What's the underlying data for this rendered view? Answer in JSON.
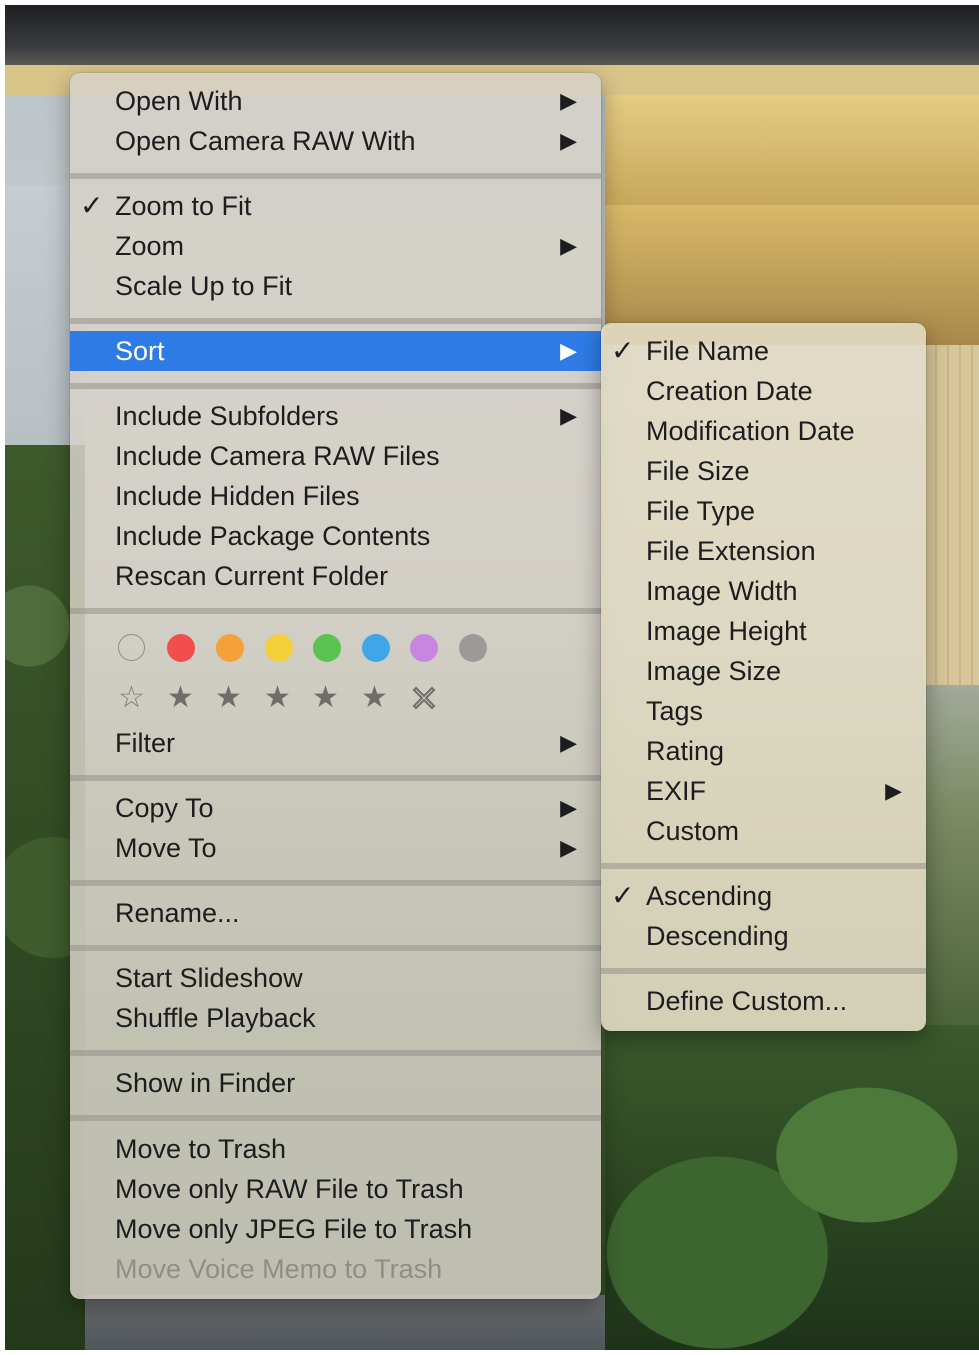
{
  "main_menu": {
    "group_open": [
      {
        "label": "Open With",
        "submenu": true
      },
      {
        "label": "Open Camera RAW With",
        "submenu": true
      }
    ],
    "group_zoom": [
      {
        "label": "Zoom to Fit",
        "checked": true
      },
      {
        "label": "Zoom",
        "submenu": true
      },
      {
        "label": "Scale Up to Fit"
      }
    ],
    "sort": {
      "label": "Sort",
      "submenu": true,
      "highlighted": true
    },
    "group_include": [
      {
        "label": "Include Subfolders",
        "submenu": true
      },
      {
        "label": "Include Camera RAW Files"
      },
      {
        "label": "Include Hidden Files"
      },
      {
        "label": "Include Package Contents"
      },
      {
        "label": "Rescan Current Folder"
      }
    ],
    "color_labels": [
      "#00000000",
      "#f24e4e",
      "#f5a13a",
      "#f3cf3c",
      "#5ac451",
      "#3fa6ea",
      "#c886e0",
      "#9c9a98"
    ],
    "rating_icons": [
      "star-outline-icon",
      "star-1-icon",
      "star-2-icon",
      "star-3-icon",
      "star-4-icon",
      "star-5-icon",
      "clear-rating-icon"
    ],
    "filter": {
      "label": "Filter",
      "submenu": true
    },
    "group_copy": [
      {
        "label": "Copy To",
        "submenu": true
      },
      {
        "label": "Move To",
        "submenu": true
      }
    ],
    "rename": {
      "label": "Rename..."
    },
    "group_slideshow": [
      {
        "label": "Start Slideshow"
      },
      {
        "label": "Shuffle Playback"
      }
    ],
    "show_in_finder": {
      "label": "Show in Finder"
    },
    "group_trash": [
      {
        "label": "Move to Trash"
      },
      {
        "label": "Move only RAW File to Trash"
      },
      {
        "label": "Move only JPEG File to Trash"
      },
      {
        "label": "Move Voice Memo to Trash",
        "disabled": true
      }
    ]
  },
  "sort_submenu": {
    "keys": [
      {
        "label": "File Name",
        "checked": true
      },
      {
        "label": "Creation Date"
      },
      {
        "label": "Modification Date"
      },
      {
        "label": "File Size"
      },
      {
        "label": "File Type"
      },
      {
        "label": "File Extension"
      },
      {
        "label": "Image Width"
      },
      {
        "label": "Image Height"
      },
      {
        "label": "Image Size"
      },
      {
        "label": "Tags"
      },
      {
        "label": "Rating"
      },
      {
        "label": "EXIF",
        "submenu": true
      },
      {
        "label": "Custom"
      }
    ],
    "order": [
      {
        "label": "Ascending",
        "checked": true
      },
      {
        "label": "Descending"
      }
    ],
    "define_custom": {
      "label": "Define Custom..."
    }
  },
  "glyphs": {
    "check": "✓",
    "arrow": "▶",
    "star_outline": "☆",
    "star": "★"
  },
  "colors": {
    "highlight": "#2f7be6"
  }
}
